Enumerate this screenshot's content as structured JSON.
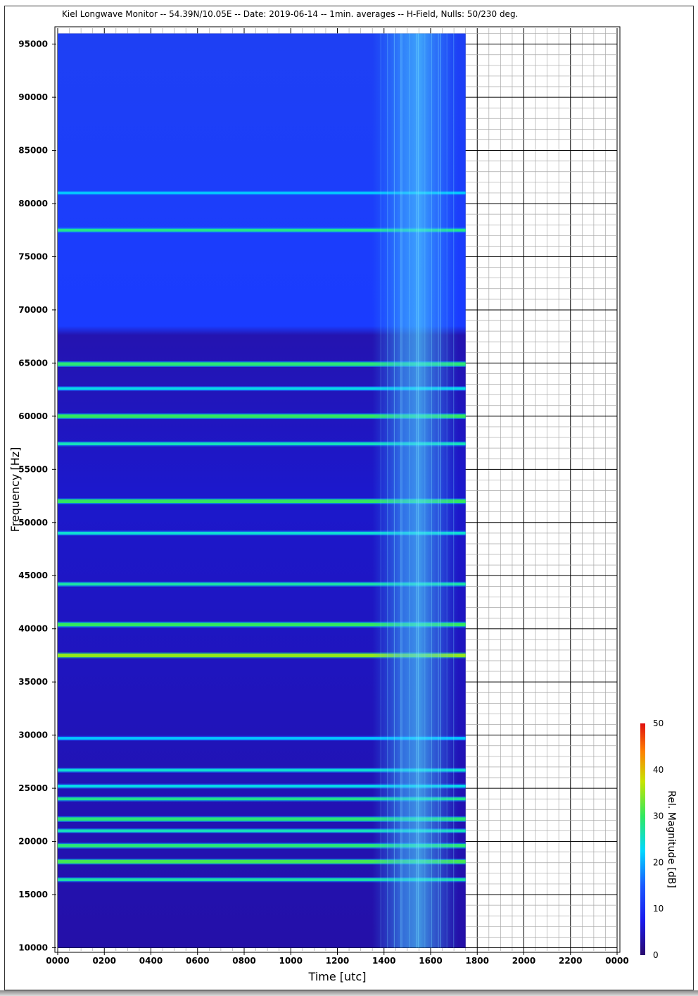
{
  "chart_data": {
    "type": "heatmap",
    "title": "Kiel Longwave Monitor -- 54.39N/10.05E -- Date: 2019-06-14 -- 1min. averages -- H-Field, Nulls: 50/230 deg.",
    "xlabel": "Time [utc]",
    "ylabel": "Frequency [Hz]",
    "xticks": [
      "0000",
      "0200",
      "0400",
      "0600",
      "0800",
      "1000",
      "1200",
      "1400",
      "1600",
      "1800",
      "2000",
      "2200",
      "0000"
    ],
    "yticks": [
      "10000",
      "15000",
      "20000",
      "25000",
      "30000",
      "35000",
      "40000",
      "45000",
      "50000",
      "55000",
      "60000",
      "65000",
      "70000",
      "75000",
      "80000",
      "85000",
      "90000",
      "95000"
    ],
    "xlim": [
      0,
      24
    ],
    "ylim": [
      9700,
      96500
    ],
    "data_end_hour": 17.5,
    "data_ymin": 10000,
    "data_ymax": 96000,
    "grid": true,
    "colorbar": {
      "label": "Rel. Magnitude [dB]",
      "range": [
        0,
        50
      ],
      "ticks": [
        "0",
        "10",
        "20",
        "30",
        "40",
        "50"
      ],
      "colors": [
        "#2a0a6e",
        "#1a1aee",
        "#1a5aff",
        "#00d8ff",
        "#30e860",
        "#c8e400",
        "#ff8000",
        "#e01010"
      ]
    },
    "station_lines_hz": [
      {
        "f": 16400,
        "db": 22
      },
      {
        "f": 18100,
        "db": 26
      },
      {
        "f": 19600,
        "db": 24
      },
      {
        "f": 21000,
        "db": 21
      },
      {
        "f": 22100,
        "db": 24
      },
      {
        "f": 24000,
        "db": 23
      },
      {
        "f": 25200,
        "db": 19
      },
      {
        "f": 26700,
        "db": 20
      },
      {
        "f": 29700,
        "db": 17
      },
      {
        "f": 37500,
        "db": 31
      },
      {
        "f": 40400,
        "db": 25
      },
      {
        "f": 44200,
        "db": 22
      },
      {
        "f": 49000,
        "db": 20
      },
      {
        "f": 52000,
        "db": 25
      },
      {
        "f": 57400,
        "db": 21
      },
      {
        "f": 60000,
        "db": 25
      },
      {
        "f": 62600,
        "db": 19
      },
      {
        "f": 64900,
        "db": 24
      },
      {
        "f": 77500,
        "db": 23
      },
      {
        "f": 81000,
        "db": 17
      }
    ],
    "noise_band_hours": [
      13.5,
      17.2
    ]
  }
}
